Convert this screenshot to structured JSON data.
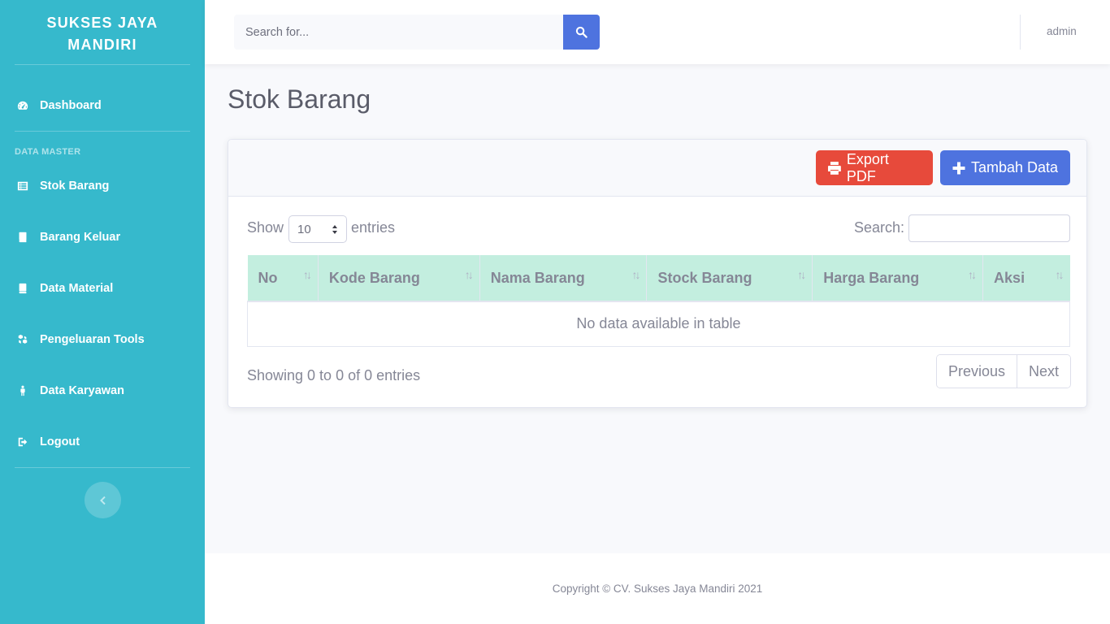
{
  "sidebar": {
    "brand": "SUKSES JAYA MANDIRI",
    "heading": "DATA MASTER",
    "items": [
      {
        "label": "Dashboard",
        "icon": "tachometer-icon"
      },
      {
        "label": "Stok Barang",
        "icon": "list-alt-icon"
      },
      {
        "label": "Barang Keluar",
        "icon": "book-icon"
      },
      {
        "label": "Data Material",
        "icon": "book-icon"
      },
      {
        "label": "Pengeluaran Tools",
        "icon": "cubes-icon"
      },
      {
        "label": "Data Karyawan",
        "icon": "male-icon"
      },
      {
        "label": "Logout",
        "icon": "sign-out-icon"
      }
    ],
    "bg_color": "#36b9cc"
  },
  "topbar": {
    "search_placeholder": "Search for...",
    "user": "admin"
  },
  "page": {
    "title": "Stok Barang",
    "export_label": "Export PDF",
    "add_label": "Tambah Data"
  },
  "table": {
    "show_label": "Show",
    "page_size": "10",
    "entries_label": "entries",
    "search_label": "Search:",
    "columns": [
      "No",
      "Kode Barang",
      "Nama Barang",
      "Stock Barang",
      "Harga Barang",
      "Aksi"
    ],
    "empty_message": "No data available in table",
    "info": "Showing 0 to 0 of 0 entries",
    "prev_label": "Previous",
    "next_label": "Next"
  },
  "footer": {
    "copyright": "Copyright © CV. Sukses Jaya Mandiri 2021"
  },
  "colors": {
    "primary": "#4e73df",
    "danger": "#e74a3b",
    "table_header": "#c3eedf"
  }
}
